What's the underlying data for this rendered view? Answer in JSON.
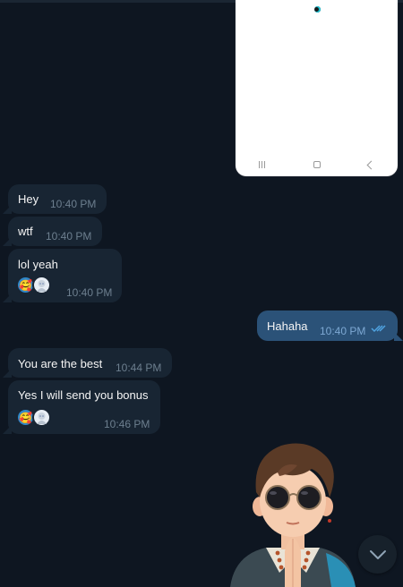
{
  "messages": [
    {
      "text": "Hey",
      "time": "10:40 PM"
    },
    {
      "text": "wtf",
      "time": "10:40 PM"
    },
    {
      "text": "lol yeah",
      "time": "10:40 PM",
      "reactions": [
        "heart-face-emoji",
        "user-avatar"
      ]
    },
    {
      "text": "Hahaha",
      "time": "10:40 PM",
      "status": "read"
    },
    {
      "text": "You are the best",
      "time": "10:44 PM"
    },
    {
      "text": "Yes I will send you bonus",
      "time": "10:46 PM",
      "reactions": [
        "heart-face-emoji",
        "user-avatar"
      ]
    }
  ],
  "reaction_emoji": "🥰",
  "colors": {
    "background": "#0e1621",
    "incoming_bubble": "#182533",
    "outgoing_bubble": "#2b5278",
    "timestamp": "#6d7f8f",
    "read_check": "#4fa3e0"
  },
  "icons": {
    "scroll_down": "chevron-down-icon",
    "read_status": "double-check-icon"
  }
}
